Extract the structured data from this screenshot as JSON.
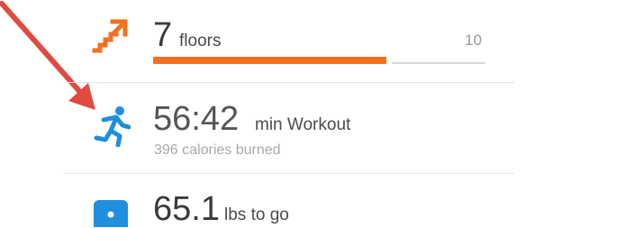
{
  "floors": {
    "value": "7",
    "unit": "floors",
    "goal": "10",
    "progress": 0.7,
    "icon": "stairs-icon",
    "accent": "#f0711f"
  },
  "workout": {
    "value": "56:42",
    "unit": "min Workout",
    "subtitle": "396 calories burned",
    "icon": "running-person-icon",
    "accent": "#1f8fde"
  },
  "weight": {
    "value": "65.1",
    "unit": "lbs to go",
    "icon": "scale-icon",
    "accent": "#1f8fde"
  },
  "annotation": {
    "icon": "red-arrow-icon",
    "color": "#e04a3f"
  }
}
